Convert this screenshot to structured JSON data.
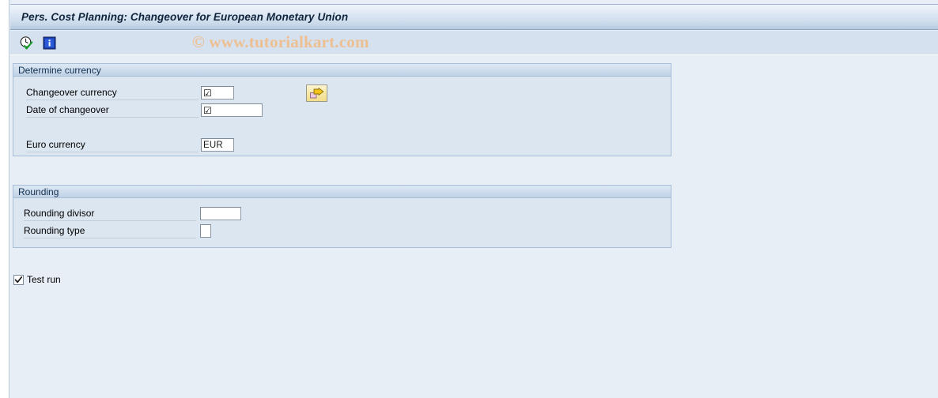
{
  "window": {
    "title": "Pers. Cost Planning: Changeover for European Monetary Union"
  },
  "toolbar": {
    "execute_label": "execute-clock-check-icon",
    "info_label": "information-icon",
    "items": [
      {
        "name": "execute-with-check-icon",
        "tooltip": "Execute"
      },
      {
        "name": "information-icon",
        "tooltip": "Information"
      }
    ]
  },
  "watermark": {
    "text": "© www.tutorialkart.com",
    "color": "#edbf91"
  },
  "panels": {
    "currency": {
      "header": "Determine currency",
      "rows": [
        {
          "label": "Changeover currency",
          "value": "",
          "glyph": "☑",
          "field_name": "changeover-currency-input"
        },
        {
          "label": "Date of changeover",
          "value": "",
          "glyph": "☑",
          "field_name": "date-of-changeover-input"
        },
        {
          "label": "Euro currency",
          "value": "EUR",
          "glyph": "",
          "field_name": "euro-currency-input"
        }
      ],
      "transfer_button": {
        "name": "transfer-arrow-button",
        "tooltip": "Transfer"
      }
    },
    "rounding": {
      "header": "Rounding",
      "rows": [
        {
          "label": "Rounding divisor",
          "value": "",
          "field_name": "rounding-divisor-input"
        },
        {
          "label": "Rounding type",
          "value": "",
          "field_name": "rounding-type-input"
        }
      ]
    }
  },
  "options": {
    "test_run": {
      "label": "Test run",
      "checked": true
    }
  },
  "colors": {
    "page_background": "#e8eef6",
    "panel_background": "#dce6f0",
    "panel_border": "#a8bed6",
    "title_text": "#10243c",
    "accent_yellow": "#f2dd8c"
  }
}
